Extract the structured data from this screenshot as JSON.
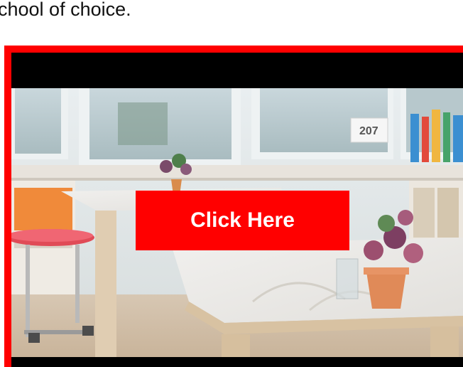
{
  "intro": {
    "text": "chool of choice."
  },
  "video": {
    "background_scene": "classroom-photo",
    "frame_color": "#ff0000",
    "letterbox_color": "#000000"
  },
  "cta": {
    "label": "Click Here",
    "background_color": "#ff0000",
    "text_color": "#ffffff"
  }
}
